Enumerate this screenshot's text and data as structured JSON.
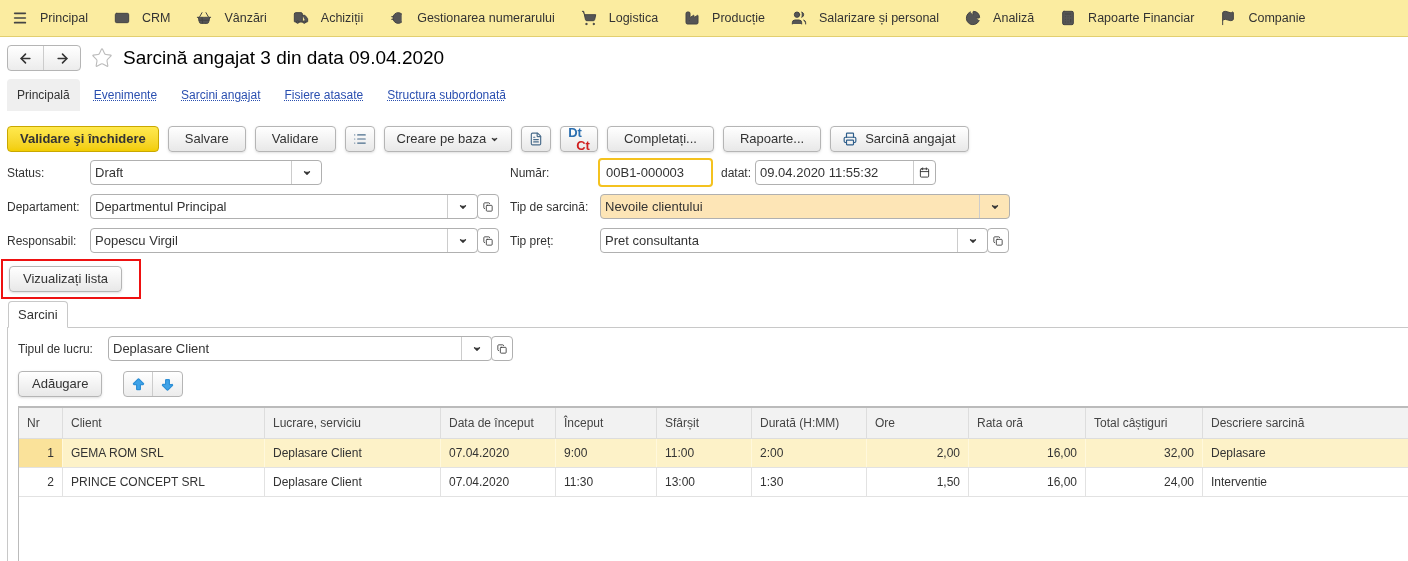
{
  "menu": [
    {
      "label": "Principal"
    },
    {
      "label": "CRM"
    },
    {
      "label": "Vânzări"
    },
    {
      "label": "Achiziții"
    },
    {
      "label": "Gestionarea numerarului"
    },
    {
      "label": "Logistica"
    },
    {
      "label": "Producție"
    },
    {
      "label": "Salarizare și personal"
    },
    {
      "label": "Analiză"
    },
    {
      "label": "Rapoarte Financiar"
    },
    {
      "label": "Companie"
    }
  ],
  "title": "Sarcină angajat 3 din data 09.04.2020",
  "favorite": false,
  "sections": [
    {
      "label": "Principală",
      "selected": true
    },
    {
      "label": "Evenimente",
      "selected": false
    },
    {
      "label": "Sarcini angajat",
      "selected": false
    },
    {
      "label": "Fisiere atasate",
      "selected": false
    },
    {
      "label": "Structura subordonată",
      "selected": false
    }
  ],
  "toolbar": [
    {
      "kind": "primary",
      "label": "Validare şi închidere"
    },
    {
      "kind": "button",
      "label": "Salvare"
    },
    {
      "kind": "button",
      "label": "Validare"
    },
    {
      "kind": "list"
    },
    {
      "kind": "dropdown",
      "label": "Creare pe baza"
    },
    {
      "kind": "document"
    },
    {
      "kind": "dtct",
      "label": "Dt",
      "label2": "Ct"
    },
    {
      "kind": "button",
      "label": "Completați..."
    },
    {
      "kind": "button",
      "label": "Rapoarte..."
    },
    {
      "kind": "print",
      "label": "Sarcină angajat"
    }
  ],
  "left_fields": [
    {
      "label": "Status:",
      "value": "Draft"
    },
    {
      "label": "Departament:",
      "value": "Departmentul Principal"
    },
    {
      "label": "Responsabil:",
      "value": "Popescu Virgil"
    }
  ],
  "number": {
    "label": "Număr:",
    "value": "00B1-000003",
    "focused": true
  },
  "date": {
    "label": "datat:",
    "value": "09.04.2020 11:55:32"
  },
  "right_fields": [
    {
      "label": "Tip de sarcină:",
      "value": "Nevoile clientului",
      "highlighted": true
    },
    {
      "label": "Tip preț:",
      "value": "Pret consultanta",
      "highlighted": false
    }
  ],
  "list_button": {
    "label": "Vizualizați lista",
    "outlined": true
  },
  "inner_tabs": [
    {
      "label": "Sarcini",
      "selected": true
    }
  ],
  "work_type": {
    "label": "Tipul de lucru:",
    "value": "Deplasare Client"
  },
  "add_button": "Adăugare",
  "table": {
    "columns": [
      "Nr",
      "Client",
      "Lucrare, serviciu",
      "Data de început",
      "Început",
      "Sfârșit",
      "Durată (H:MM)",
      "Ore",
      "Rata oră",
      "Total câștiguri",
      "Descriere sarcină"
    ],
    "rows": [
      {
        "selected": true,
        "cells": [
          "1",
          "GEMA ROM SRL",
          "Deplasare Client",
          "07.04.2020",
          "9:00",
          "11:00",
          "2:00",
          "2,00",
          "16,00",
          "32,00",
          "Deplasare"
        ]
      },
      {
        "selected": false,
        "cells": [
          "2",
          "PRINCE CONCEPT SRL",
          "Deplasare Client",
          "07.04.2020",
          "11:30",
          "13:00",
          "1:30",
          "1,50",
          "16,00",
          "24,00",
          "Interventie"
        ]
      }
    ]
  }
}
